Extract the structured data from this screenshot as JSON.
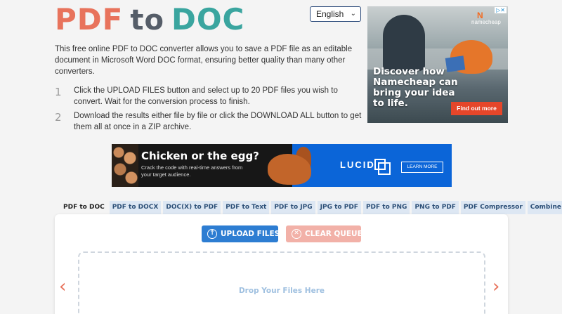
{
  "logo": {
    "pdf": "PDF",
    "to": "to",
    "doc": "DOC"
  },
  "language": {
    "selected": "English"
  },
  "intro": "This free online PDF to DOC converter allows you to save a PDF file as an editable document in Microsoft Word DOC format, ensuring better quality than many other converters.",
  "steps": [
    {
      "num": "1",
      "text": "Click the UPLOAD FILES button and select up to 20 PDF files you wish to convert. Wait for the conversion process to finish."
    },
    {
      "num": "2",
      "text": "Download the results either file by file or click the DOWNLOAD ALL button to get them all at once in a ZIP archive."
    }
  ],
  "ad_side": {
    "brand": "namecheap",
    "headline": "Discover how Namecheap can bring your idea to life.",
    "cta": "Find out more"
  },
  "ad_banner": {
    "headline": "Chicken or the egg?",
    "subtext": "Crack the code with real-time answers from your target audience.",
    "brand": "LUCID",
    "cta": "LEARN MORE"
  },
  "tabs": [
    {
      "label": "PDF to DOC",
      "active": true
    },
    {
      "label": "PDF to DOCX"
    },
    {
      "label": "DOC(X) to PDF"
    },
    {
      "label": "PDF to Text"
    },
    {
      "label": "PDF to JPG"
    },
    {
      "label": "JPG to PDF"
    },
    {
      "label": "PDF to PNG"
    },
    {
      "label": "PNG to PDF"
    },
    {
      "label": "PDF Compressor"
    },
    {
      "label": "Combine PDF"
    }
  ],
  "converter": {
    "upload_label": "UPLOAD FILES",
    "clear_label": "CLEAR QUEUE",
    "drop_label": "Drop Your Files Here"
  },
  "colors": {
    "accent_orange": "#e8735c",
    "accent_teal": "#3aa59f",
    "upload_blue": "#2d7dd2",
    "clear_pink": "#f2b1a8"
  }
}
